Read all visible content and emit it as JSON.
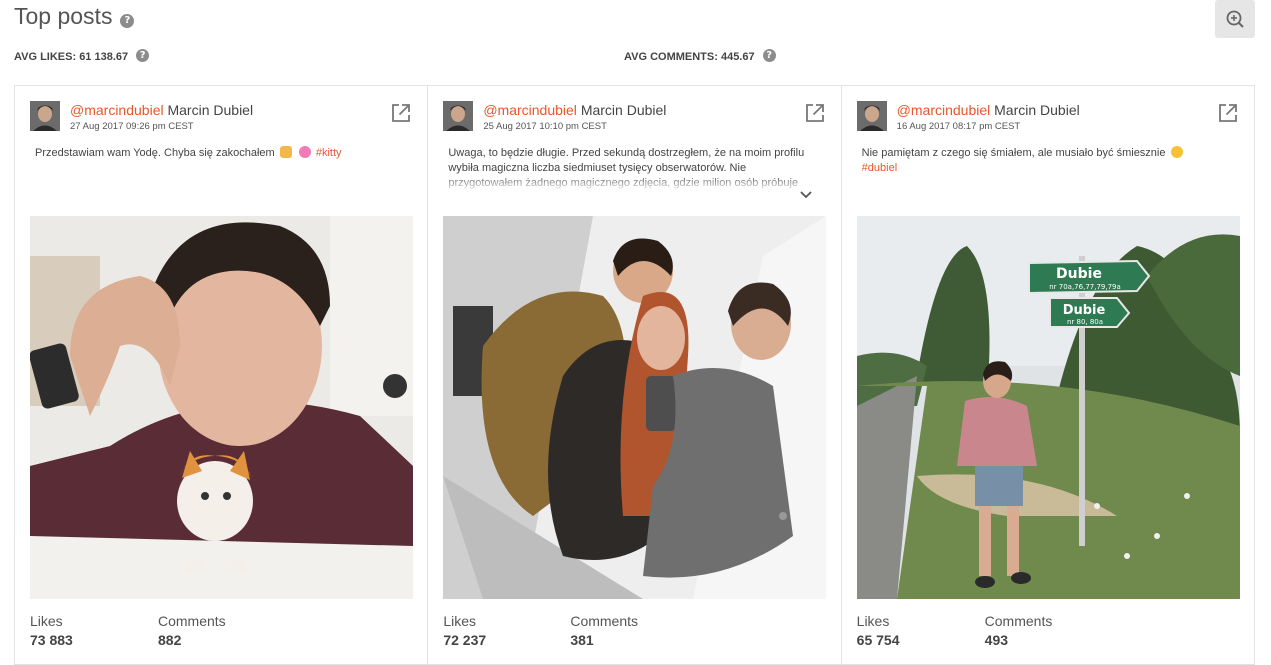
{
  "header": {
    "title": "Top posts",
    "avg_likes": "AVG LIKES: 61 138.67",
    "avg_comments": "AVG COMMENTS: 445.67"
  },
  "labels": {
    "likes": "Likes",
    "comments": "Comments"
  },
  "posts": [
    {
      "handle": "@marcindubiel",
      "name": "Marcin Dubiel",
      "date": "27 Aug 2017 09:26 pm CEST",
      "caption_text": "Przedstawiam wam Yodę. Chyba się zakochałem",
      "hashtag": "#kitty",
      "likes": "73 883",
      "comments": "882"
    },
    {
      "handle": "@marcindubiel",
      "name": "Marcin Dubiel",
      "date": "25 Aug 2017 10:10 pm CEST",
      "caption_text": "Uwaga, to będzie długie. Przed sekundą dostrzegłem, że na moim profilu wybiła magiczna liczba siedmiuset tysięcy obserwatorów. Nie przygotowałem żadnego magicznego zdjęcia, gdzie milion osób próbuje",
      "likes": "72 237",
      "comments": "381"
    },
    {
      "handle": "@marcindubiel",
      "name": "Marcin Dubiel",
      "date": "16 Aug 2017 08:17 pm CEST",
      "caption_text": "Nie pamiętam z czego się śmiałem, ale musiało być śmiesznie",
      "hashtag": "#dubiel",
      "likes": "65 754",
      "comments": "493"
    }
  ],
  "signs": {
    "top": "Dubie",
    "top_sub": "nr 70a,76,77,79,79a",
    "bottom": "Dubie",
    "bottom_sub": "nr 80, 80a"
  },
  "icons": [
    "help-icon",
    "zoom-in-icon",
    "external-link-icon",
    "chevron-down-icon"
  ],
  "colors": {
    "accent": "#e8572a",
    "text": "#444444",
    "border": "#e3e3e3"
  }
}
